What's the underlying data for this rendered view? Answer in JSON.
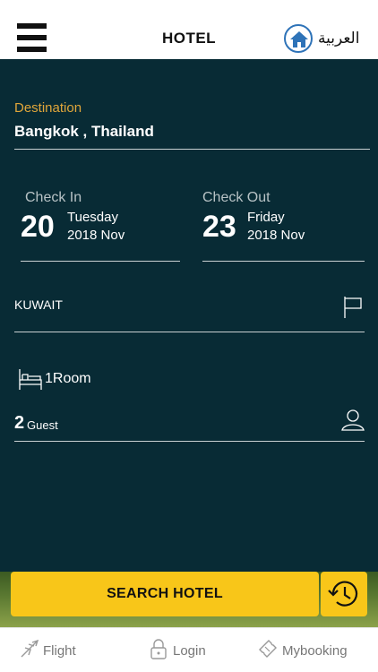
{
  "header": {
    "title": "HOTEL",
    "language": "العربية"
  },
  "search": {
    "destination_label": "Destination",
    "destination_value": "Bangkok , Thailand",
    "check_in": {
      "label": "Check In",
      "day": "20",
      "weekday": "Tuesday",
      "year_month": "2018 Nov"
    },
    "check_out": {
      "label": "Check Out",
      "day": "23",
      "weekday": "Friday",
      "year_month": "2018 Nov"
    },
    "nationality": "KUWAIT",
    "rooms": "1Room",
    "guests_count": "2",
    "guests_label": "Guest",
    "search_button": "SEARCH HOTEL"
  },
  "tabs": [
    {
      "label": "Flight",
      "icon": "plane-icon"
    },
    {
      "label": "Login",
      "icon": "lock-icon"
    },
    {
      "label": "Mybooking",
      "icon": "ticket-icon"
    }
  ],
  "colors": {
    "background": "#082b35",
    "accent": "#f8c619",
    "label": "#e0a63a",
    "home_icon": "#2e73b8"
  }
}
